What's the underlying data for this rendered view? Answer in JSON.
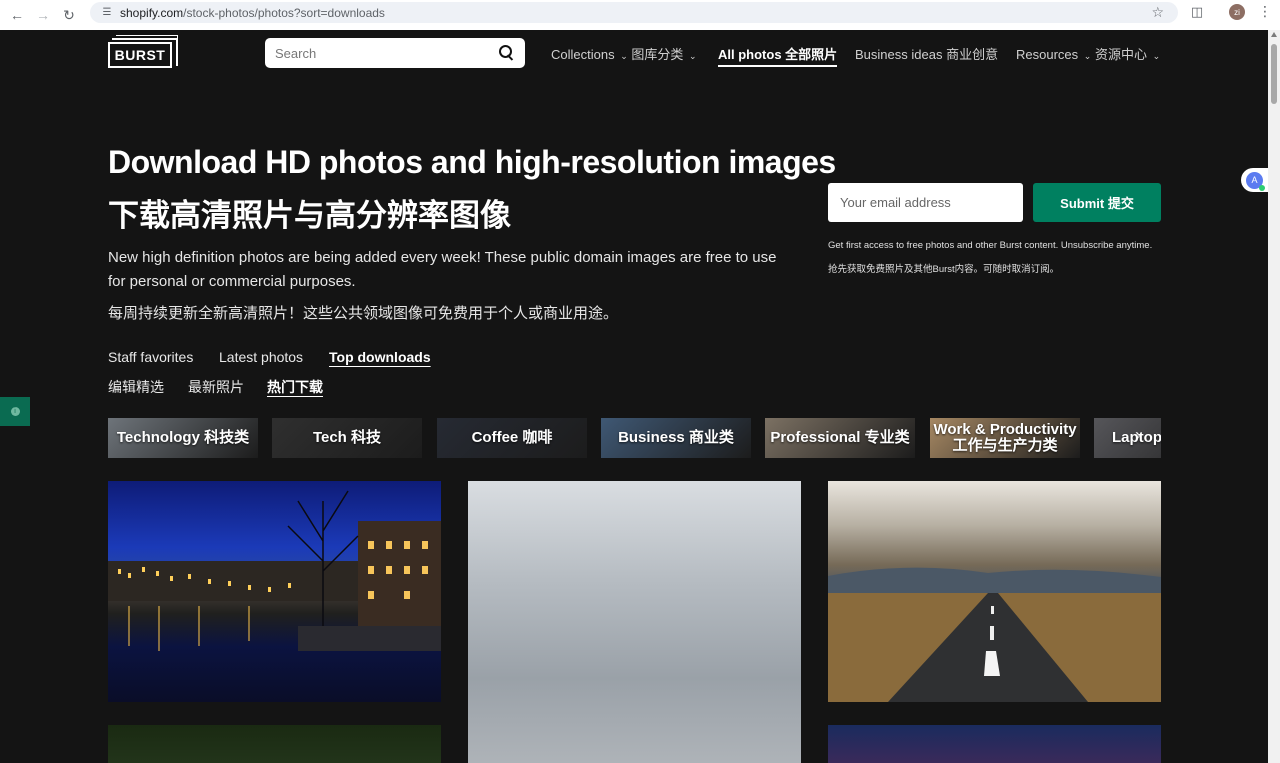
{
  "browser": {
    "url_domain": "shopify.com",
    "url_path": "/stock-photos/photos?sort=downloads",
    "avatar_initials": "zi"
  },
  "header": {
    "logo_text": "BURST",
    "search_placeholder": "Search",
    "nav": [
      {
        "label": "Collections",
        "label_cn": "图库分类",
        "has_menu": true
      },
      {
        "label": "All photos",
        "label_cn": "全部照片",
        "active": true
      },
      {
        "label": "Business ideas",
        "label_cn": "商业创意"
      },
      {
        "label": "Resources",
        "label_cn": "资源中心",
        "has_menu": true
      }
    ]
  },
  "hero": {
    "title": "Download HD photos and high-resolution images",
    "title_cn": "下载高清照片与高分辨率图像",
    "description": "New high definition photos are being added every week! These public domain images are free to use for personal or commercial purposes.",
    "description_cn": "每周持续更新全新高清照片！这些公共领域图像可免费用于个人或商业用途。"
  },
  "signup": {
    "email_placeholder": "Your email address",
    "submit_label": "Submit 提交",
    "note": "Get first access to free photos and other Burst content. Unsubscribe anytime.",
    "note_cn": "抢先获取免费照片及其他Burst内容。可随时取消订阅。"
  },
  "tabs": [
    {
      "label": "Staff favorites",
      "label_cn": "编辑精选"
    },
    {
      "label": "Latest photos",
      "label_cn": "最新照片"
    },
    {
      "label": "Top downloads",
      "label_cn": "热门下载",
      "active": true
    }
  ],
  "categories": [
    {
      "label": "Technology 科技类",
      "color": "#6e747a"
    },
    {
      "label": "Tech 科技",
      "color": "#2f2f2f"
    },
    {
      "label": "Coffee 咖啡",
      "color": "#262a33"
    },
    {
      "label": "Business 商业类",
      "color": "#3f5874"
    },
    {
      "label": "Professional 专业类",
      "color": "#7c7163"
    },
    {
      "label": "Work & Productivity 工作与生产力类",
      "color": "#a68863"
    },
    {
      "label": "Laptop",
      "color": "#56565a"
    }
  ],
  "colors": {
    "background": "#141414",
    "accent": "#008060"
  }
}
